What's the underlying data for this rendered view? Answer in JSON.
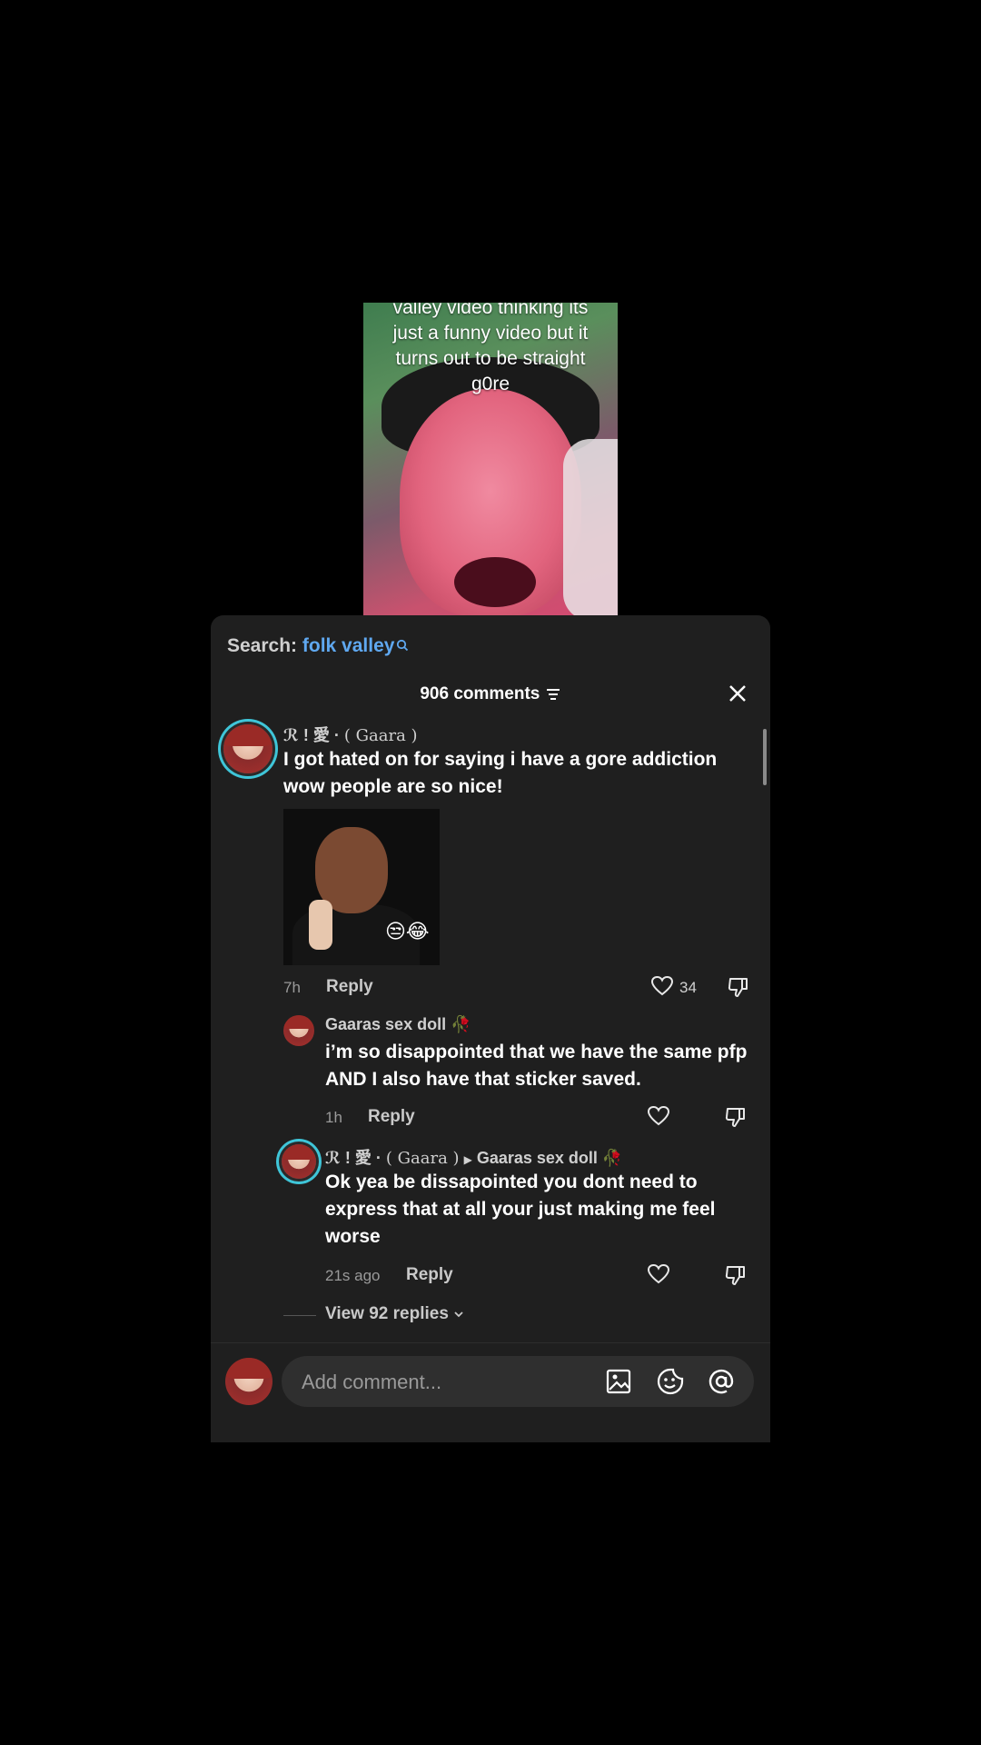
{
  "video": {
    "caption_lines": [
      "valley video thinking its",
      "just a funny video but it",
      "turns out to be straight",
      "g0re"
    ]
  },
  "comments_sheet": {
    "search_label": "Search:",
    "search_term": "folk valley",
    "comment_count": "906 comments",
    "comments": [
      {
        "username_prefix": "ℛ ! 愛 · ",
        "username_main": "( Gaara )",
        "text": "I got hated on for saying i have a gore addiction wow people are so nice!",
        "sticker_emoji": "😒😂",
        "time": "7h",
        "reply_label": "Reply",
        "likes": "34"
      },
      {
        "username": "Gaaras sex doll 🥀",
        "text": "i’m so disappointed that we have the same pfp AND I also have that sticker saved.",
        "time": "1h",
        "reply_label": "Reply"
      },
      {
        "username_prefix": "ℛ ! 愛 · ",
        "username_main": "( Gaara )",
        "reply_to": "Gaaras sex doll 🥀",
        "text": "Ok yea be dissapointed you dont need to express that at all your just making me feel worse",
        "time": "21s ago",
        "reply_label": "Reply"
      }
    ],
    "view_replies": "View 92 replies",
    "input_placeholder": "Add comment..."
  },
  "icons": [
    "search-icon",
    "filter-icon",
    "close-icon",
    "heart-icon",
    "dislike-icon",
    "image-icon",
    "emoji-icon",
    "mention-icon",
    "chevron-down-icon"
  ]
}
